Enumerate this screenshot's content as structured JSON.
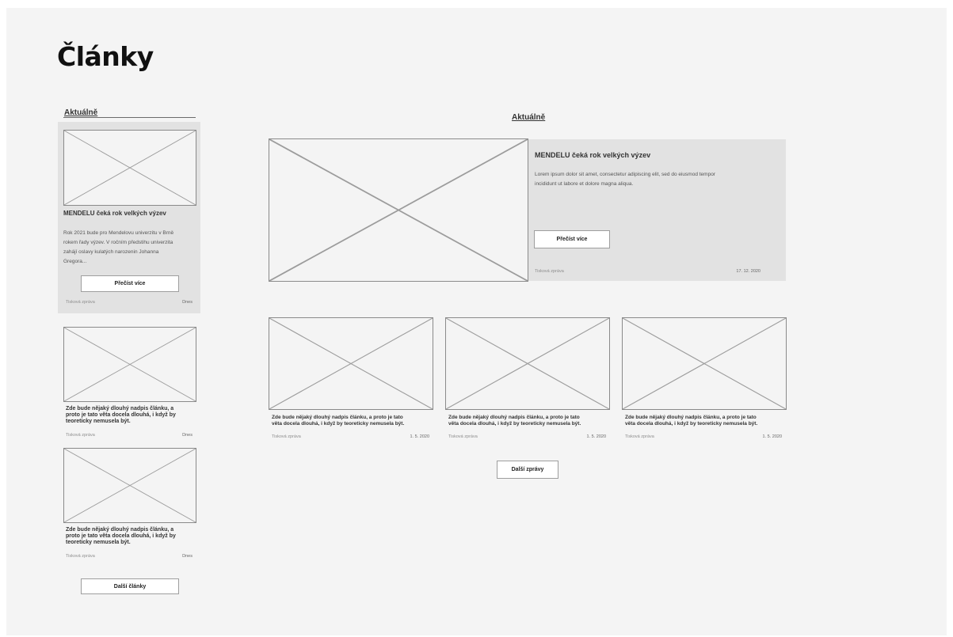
{
  "page": {
    "title": "Články"
  },
  "sidebar": {
    "section_label": "Aktuálně",
    "featured": {
      "title": "MENDELU čeká rok velkých výzev",
      "excerpt_lines": [
        "Rok 2021 bude pro Mendelovu univerzitu v Brně",
        "rokem řady výzev. V ročním předstihu univerzita",
        "zahájí oslavy kulatých narozenin Johanna",
        "Gregora..."
      ],
      "button_label": "Přečíst více",
      "category": "Tisková zpráva",
      "date": "Dnes"
    },
    "articles": [
      {
        "title_lines": [
          "Zde bude nějaký dlouhý nadpis článku, a",
          "proto je tato věta docela dlouhá, i když by",
          "teoreticky nemusela být."
        ],
        "category": "Tisková zpráva",
        "date": "Dnes"
      },
      {
        "title_lines": [
          "Zde bude nějaký dlouhý nadpis článku, a",
          "proto je tato věta docela dlouhá, i když by",
          "teoreticky nemusela být."
        ],
        "category": "Tisková zpráva",
        "date": "Dnes"
      }
    ],
    "more_button": "Další články"
  },
  "main": {
    "section_label": "Aktuálně",
    "hero": {
      "title": "MENDELU čeká rok velkých výzev",
      "excerpt_lines": [
        "Lorem ipsum dolor sit amet, consectetur adipiscing elit, sed do eiusmod tempor",
        "incididunt ut labore et dolore magna aliqua."
      ],
      "button_label": "Přečíst více",
      "category": "Tisková zpráva",
      "date": "17. 12. 2020"
    },
    "news": [
      {
        "title_lines": [
          "Zde bude nějaký dlouhý nadpis článku, a proto je tato",
          "věta docela dlouhá, i když by teoreticky nemusela být."
        ],
        "category": "Tisková zpráva",
        "date": "1. 5. 2020"
      },
      {
        "title_lines": [
          "Zde bude nějaký dlouhý nadpis článku, a proto je tato",
          "věta docela dlouhá, i když by teoreticky nemusela být."
        ],
        "category": "Tisková zpráva",
        "date": "1. 5. 2020"
      },
      {
        "title_lines": [
          "Zde bude nějaký dlouhý nadpis článku, a proto je tato",
          "věta docela dlouhá, i když by teoreticky nemusela být."
        ],
        "category": "Tisková zpráva",
        "date": "1. 5. 2020"
      }
    ],
    "more_button": "Další zprávy"
  }
}
